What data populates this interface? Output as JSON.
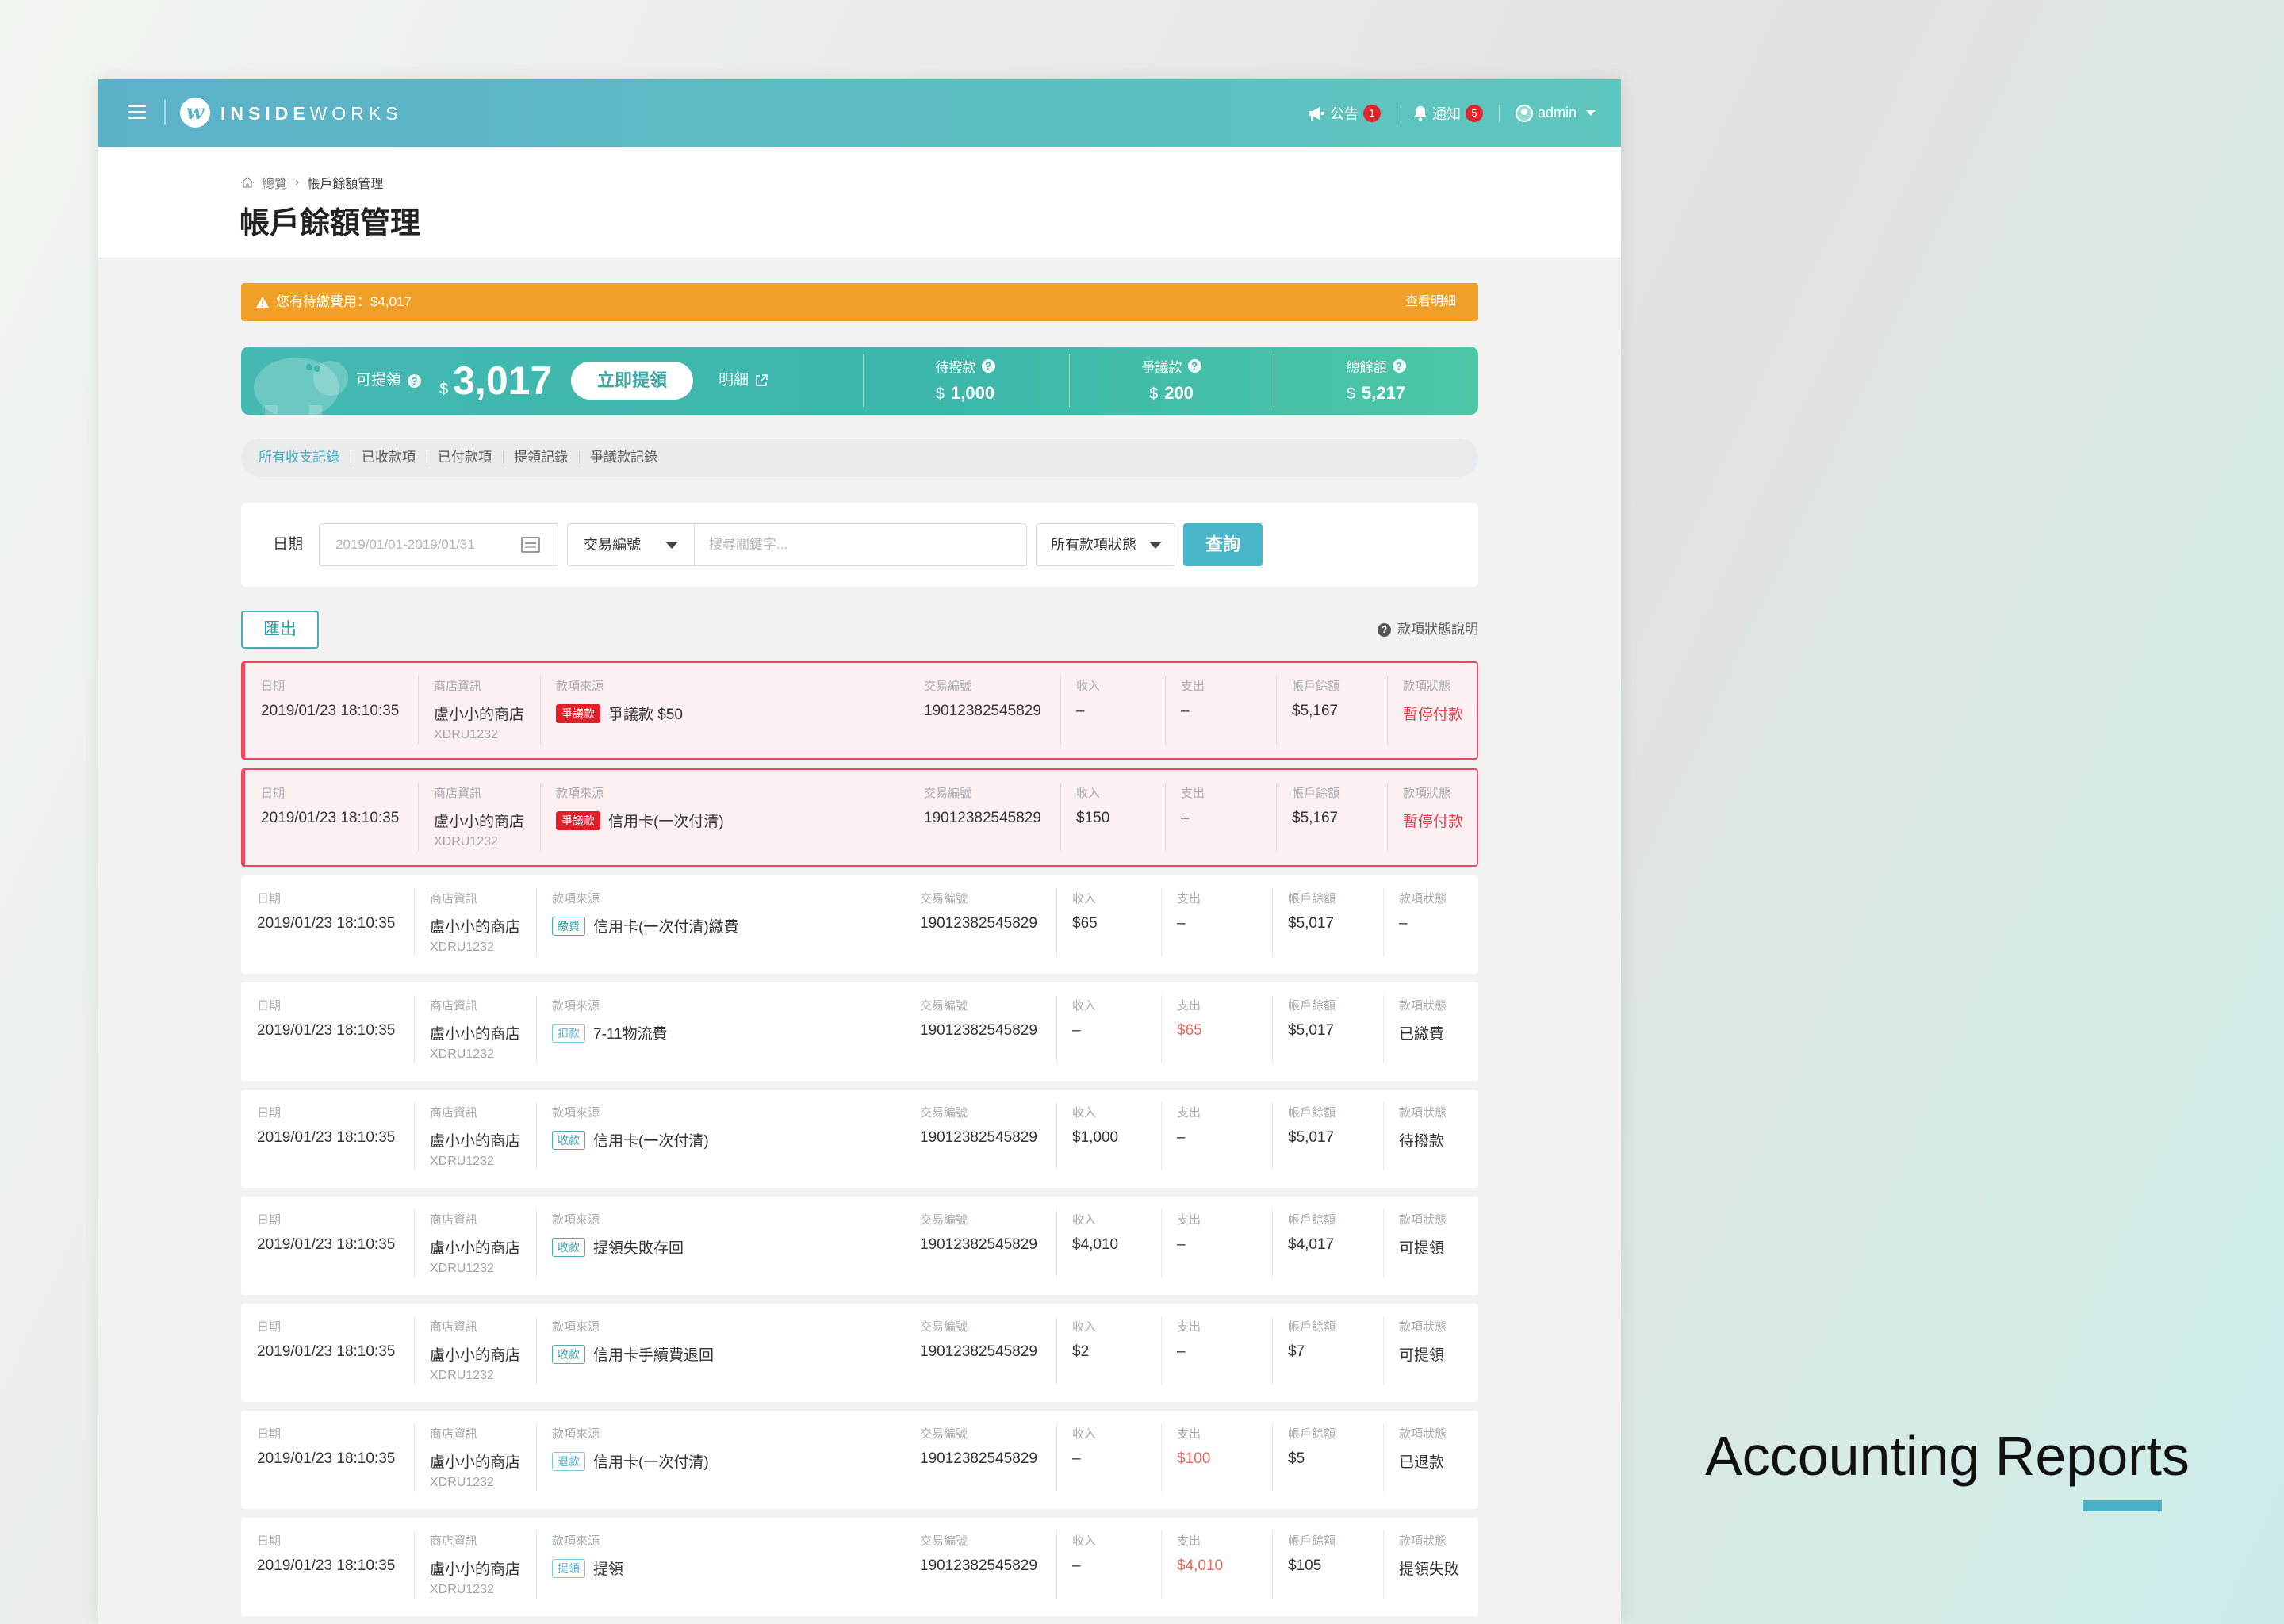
{
  "app": {
    "logo_mark": "w",
    "logo_bold": "INSIDE",
    "logo_light": "WORKS"
  },
  "nav": {
    "announcements": {
      "label": "公告",
      "count": "1",
      "icon": "megaphone-icon"
    },
    "notifications": {
      "label": "通知",
      "count": "5",
      "icon": "bell-icon"
    },
    "user": {
      "label": "admin",
      "icon": "user-icon"
    }
  },
  "breadcrumb": {
    "home": "總覽",
    "current": "帳戶餘額管理"
  },
  "page_title": "帳戶餘額管理",
  "alert": {
    "text": "您有待繳費用：$4,017",
    "link": "查看明細",
    "icon": "warning-icon"
  },
  "summary": {
    "available_label": "可提領",
    "currency": "$",
    "available_amount": "3,017",
    "withdraw_button": "立即提領",
    "detail_link": "明細",
    "stats": [
      {
        "label": "待撥款",
        "currency": "$",
        "value": "1,000"
      },
      {
        "label": "爭議款",
        "currency": "$",
        "value": "200"
      },
      {
        "label": "總餘額",
        "currency": "$",
        "value": "5,217"
      }
    ]
  },
  "tabs": [
    "所有收支記錄",
    "已收款項",
    "已付款項",
    "提領記錄",
    "爭議款記錄"
  ],
  "active_tab": 0,
  "filter": {
    "date_label": "日期",
    "date_placeholder": "2019/01/01-2019/01/31",
    "field_select": "交易編號",
    "keyword_placeholder": "搜尋關鍵字...",
    "status_select": "所有款項狀態",
    "search_button": "查詢"
  },
  "export_button": "匯出",
  "status_help": "款項狀態說明",
  "columns": {
    "date": "日期",
    "store": "商店資訊",
    "source": "款項來源",
    "txn": "交易編號",
    "income": "收入",
    "expense": "支出",
    "balance": "帳戶餘額",
    "status": "款項狀態"
  },
  "rows": [
    {
      "date": "2019/01/23 18:10:35",
      "store": "盧小小的商店",
      "store_code": "XDRU1232",
      "tag": "爭議款",
      "source": "爭議款 $50",
      "txn": "19012382545829",
      "income": "–",
      "expense": "–",
      "balance": "$5,167",
      "status": "暫停付款"
    },
    {
      "date": "2019/01/23 18:10:35",
      "store": "盧小小的商店",
      "store_code": "XDRU1232",
      "tag": "爭議款",
      "source": "信用卡(一次付清)",
      "txn": "19012382545829",
      "income": "$150",
      "expense": "–",
      "balance": "$5,167",
      "status": "暫停付款"
    },
    {
      "date": "2019/01/23 18:10:35",
      "store": "盧小小的商店",
      "store_code": "XDRU1232",
      "tag": "繳費",
      "source": "信用卡(一次付清)繳費",
      "txn": "19012382545829",
      "income": "$65",
      "expense": "–",
      "balance": "$5,017",
      "status": "–"
    },
    {
      "date": "2019/01/23 18:10:35",
      "store": "盧小小的商店",
      "store_code": "XDRU1232",
      "tag": "扣款",
      "source": "7-11物流費",
      "txn": "19012382545829",
      "income": "–",
      "expense": "$65",
      "balance": "$5,017",
      "status": "已繳費"
    },
    {
      "date": "2019/01/23 18:10:35",
      "store": "盧小小的商店",
      "store_code": "XDRU1232",
      "tag": "收款",
      "source": "信用卡(一次付清)",
      "txn": "19012382545829",
      "income": "$1,000",
      "expense": "–",
      "balance": "$5,017",
      "status": "待撥款"
    },
    {
      "date": "2019/01/23 18:10:35",
      "store": "盧小小的商店",
      "store_code": "XDRU1232",
      "tag": "收款",
      "source": "提領失敗存回",
      "txn": "19012382545829",
      "income": "$4,010",
      "expense": "–",
      "balance": "$4,017",
      "status": "可提領"
    },
    {
      "date": "2019/01/23 18:10:35",
      "store": "盧小小的商店",
      "store_code": "XDRU1232",
      "tag": "收款",
      "source": "信用卡手續費退回",
      "txn": "19012382545829",
      "income": "$2",
      "expense": "–",
      "balance": "$7",
      "status": "可提領"
    },
    {
      "date": "2019/01/23 18:10:35",
      "store": "盧小小的商店",
      "store_code": "XDRU1232",
      "tag": "退款",
      "source": "信用卡(一次付清)",
      "txn": "19012382545829",
      "income": "–",
      "expense": "$100",
      "balance": "$5",
      "status": "已退款"
    },
    {
      "date": "2019/01/23 18:10:35",
      "store": "盧小小的商店",
      "store_code": "XDRU1232",
      "tag": "提領",
      "source": "提領",
      "txn": "19012382545829",
      "income": "–",
      "expense": "$4,010",
      "balance": "$105",
      "status": "提領失敗"
    }
  ],
  "side_caption": "Accounting Reports",
  "colors": {
    "topbar_start": "#5cb1c9",
    "topbar_end": "#5ec7bd",
    "alert_bg": "#f0a028",
    "summary_bg": "#3cb6aa",
    "accent": "#47b6c9",
    "dispute_red": "#e21e2a",
    "expense_red": "#f06a5c"
  }
}
